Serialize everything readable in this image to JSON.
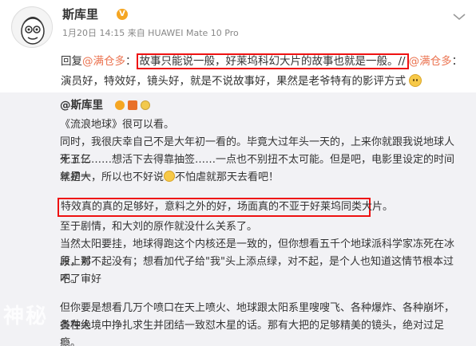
{
  "post": {
    "username": "斯库里",
    "verified_badge": "V",
    "meta": "1月20日 14:15 来自 HUAWEI Mate 10 Pro",
    "reply_prefix": "回复",
    "reply_at": "@满仓多",
    "reply_colon": "：",
    "reply_highlight": "故事只能说一般",
    "reply_after_highlight": "，好莱坞科幻大片的故事也就是一般。//",
    "reply_at2": "@满仓多",
    "reply_line2": "：演员好，特效好，镜头好，就是不说故事好，果然是老爷特有的影评方式"
  },
  "quoted": {
    "username": "@斯库里",
    "para1": "《流浪地球》很可以看。",
    "para2_l1": "同时，我很庆幸自己不是大年初一看的。毕竟大过年头一天的，上来你就跟我说地球人死了三",
    "para2_l2": "十五亿……想活下去得靠抽签……一点也不别扭不太可能。但是吧，电影里设定的时间就是大",
    "para2_l3": "年初一，所以也不好说",
    "para2_l3b": "不怕虐就那天去看吧！",
    "highlight": "特效真的真的足够好，意料之外的好，场面真的不亚于好莱坞同类大片。",
    "para4": "至于剧情，和大刘的原作就没什么关系了。",
    "para5_l1": "当然太阳要挂，地球得跑这个内核还是一致的，但你想看五千个地球派科学家冻死在冰原上那",
    "para5_l2": "段，对不起没有；想看加代子给\"我\"头上添点绿，对不起，是个人也知道这情节根本过不了审好",
    "para5_l3": "吧。",
    "para6_l1": "但你要是想看几万个喷口在天上喷火、地球跟太阳系里嗖嗖飞、各种爆炸、各种崩坏，各种人",
    "para6_l2": "类在绝境中挣扎求生并团结一致怼木星的话。那有大把的足够精美的镜头，绝对过足瘾。",
    "watermark": "神秘"
  }
}
